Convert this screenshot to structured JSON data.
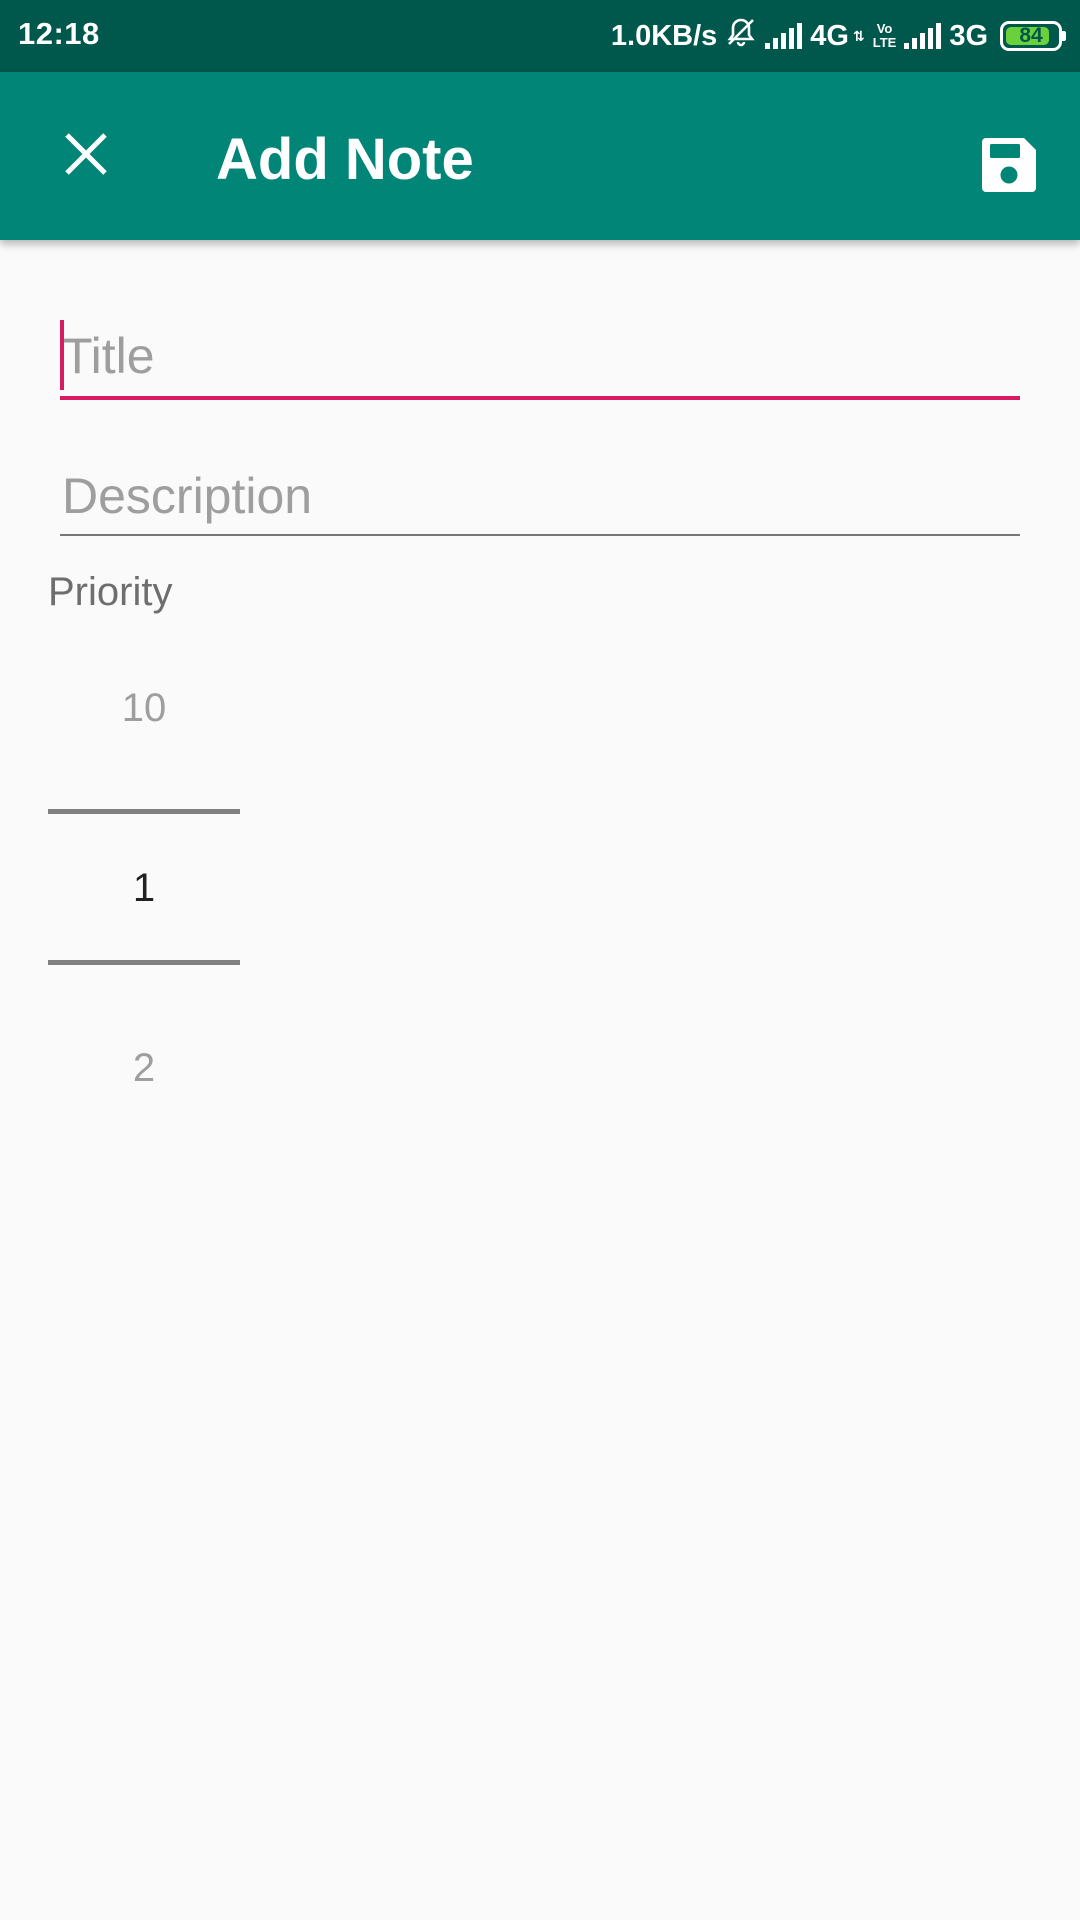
{
  "status_bar": {
    "time": "12:18",
    "net_speed": "1.0KB/s",
    "net1": "4G",
    "volte_top": "Vo",
    "volte_bottom": "LTE",
    "net2": "3G",
    "battery": "84",
    "icons": [
      "muted-bell-icon",
      "signal-icon",
      "data-arrows-icon",
      "signal-icon",
      "battery-icon"
    ]
  },
  "app_bar": {
    "title": "Add Note",
    "close_icon": "close-icon",
    "save_icon": "save-icon",
    "color": "#008577"
  },
  "form": {
    "title_placeholder": "Title",
    "description_placeholder": "Description",
    "priority_label": "Priority"
  },
  "picker": {
    "prev": "10",
    "selected": "1",
    "next": "2"
  },
  "colors": {
    "status_bar": "#00574b",
    "accent": "#d81b60",
    "background": "#fafafa"
  }
}
